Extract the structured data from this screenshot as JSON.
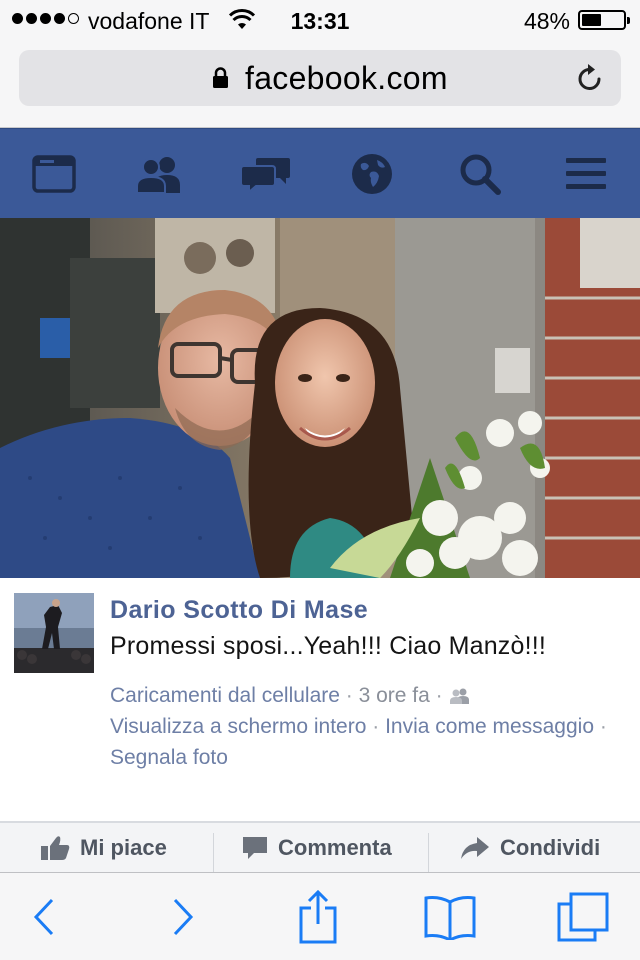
{
  "status_bar": {
    "carrier": "vodafone IT",
    "time": "13:31",
    "battery_percent": "48%",
    "battery_level": 0.48,
    "signal_bars_filled": 4,
    "signal_bars_total": 5
  },
  "browser": {
    "url": "facebook.com"
  },
  "fb_nav": {
    "background": "#3b5998",
    "items": [
      "news-feed-icon",
      "friend-requests-icon",
      "messages-icon",
      "notifications-globe-icon",
      "search-icon",
      "menu-icon"
    ]
  },
  "post": {
    "author": "Dario Scotto Di Mase",
    "caption": "Promessi sposi...Yeah!!! Ciao Manzò!!!",
    "album": "Caricamenti dal cellulare",
    "dot1": " · ",
    "time_ago": "3 ore fa",
    "dot2": " · ",
    "view_fullscreen": "Visualizza a schermo intero",
    "dot3": " · ",
    "send_message": "Invia come messaggio",
    "dot4": " · ",
    "report": "Segnala foto"
  },
  "actions": {
    "like": "Mi piace",
    "comment": "Commenta",
    "share": "Condividi"
  },
  "toolbar": {
    "items": [
      "back-icon",
      "forward-icon",
      "share-icon",
      "bookmarks-icon",
      "tabs-icon"
    ],
    "tint": "#1a7cf5"
  }
}
